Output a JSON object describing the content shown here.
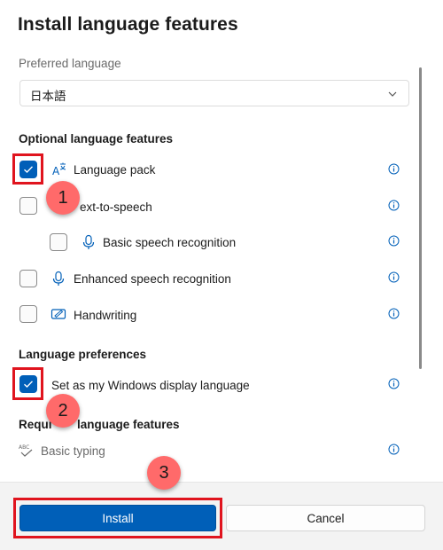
{
  "dialog": {
    "title": "Install language features",
    "preferred_label": "Preferred language",
    "preferred_value": "日本語"
  },
  "optional": {
    "heading": "Optional language features",
    "items": [
      {
        "label": "Language pack",
        "checked": true,
        "icon": "language-icon"
      },
      {
        "label": "ext-to-speech",
        "checked": false,
        "icon": "text-to-speech-icon"
      },
      {
        "label": "Basic speech recognition",
        "checked": false,
        "icon": "microphone-icon"
      },
      {
        "label": "Enhanced speech recognition",
        "checked": false,
        "icon": "microphone-icon"
      },
      {
        "label": "Handwriting",
        "checked": false,
        "icon": "handwriting-icon"
      }
    ]
  },
  "preferences": {
    "heading": "Language preferences",
    "display_language_label": "Set as my Windows display language",
    "display_language_checked": true
  },
  "required": {
    "heading_left": "Requi",
    "heading_right": "language features",
    "basic_typing_label": "Basic typing"
  },
  "footer": {
    "install_label": "Install",
    "cancel_label": "Cancel"
  },
  "annotations": {
    "step1": "1",
    "step2": "2",
    "step3": "3",
    "color": "#e0141e",
    "badge_color": "#ff6a6a"
  },
  "colors": {
    "accent": "#005fb8"
  }
}
